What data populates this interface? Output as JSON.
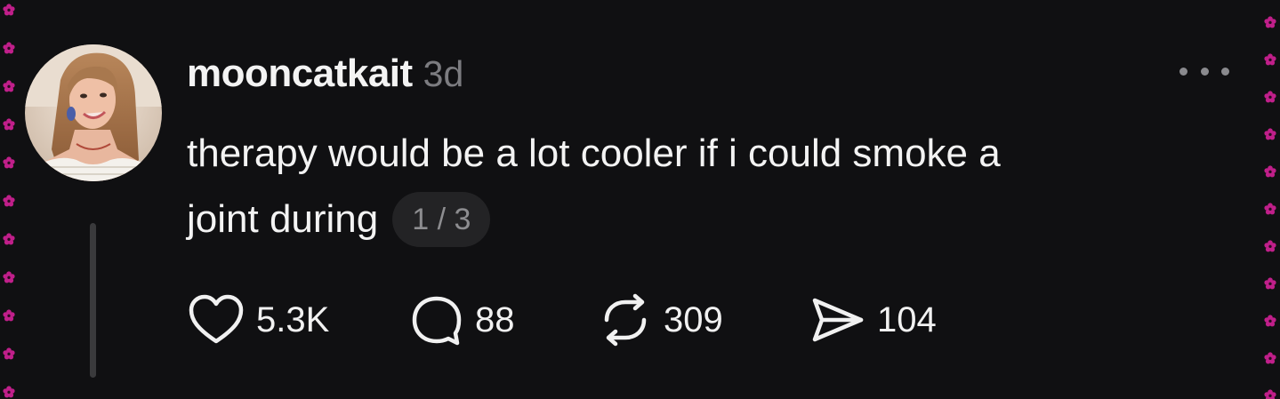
{
  "post": {
    "username": "mooncatkait",
    "timestamp": "3d",
    "text_line1": "therapy would be a lot cooler if i could smoke a",
    "text_line2": "joint during",
    "page_indicator": "1 / 3",
    "avatar_description": "profile photo",
    "more_icon": "more-horizontal-icon"
  },
  "actions": {
    "likes": "5.3K",
    "replies": "88",
    "reposts": "309",
    "shares": "104"
  },
  "colors": {
    "background": "#101012",
    "text": "#f3f3f3",
    "muted": "#7c7c80",
    "pill": "#232325",
    "flower": "#c01f8a"
  }
}
